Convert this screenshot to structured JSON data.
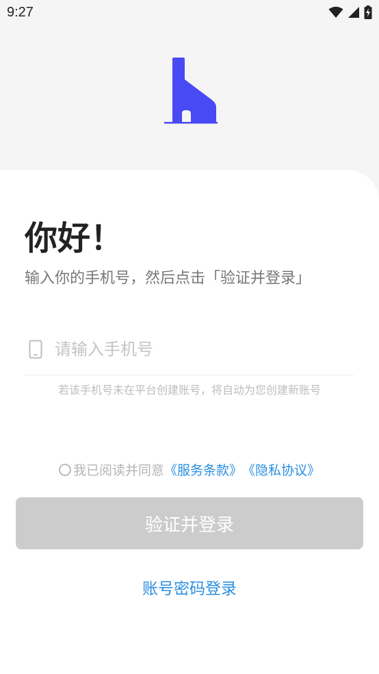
{
  "status_bar": {
    "time": "9:27",
    "icons": [
      "wifi-icon",
      "signal-icon",
      "battery-charging-icon"
    ]
  },
  "colors": {
    "brand": "#4a4af4",
    "link": "#2b8fe0",
    "button_disabled": "#cccccc",
    "background": "#f5f5f5"
  },
  "login": {
    "greeting": "你好！",
    "subtitle": "输入你的手机号，然后点击「验证并登录」",
    "phone_placeholder": "请输入手机号",
    "phone_value": "",
    "hint": "若该手机号未在平台创建账号，将自动为您创建新账号",
    "agreement": {
      "prefix": "我已阅读并同意",
      "terms_link": "《服务条款》",
      "privacy_link": "《隐私协议》"
    },
    "submit_label": "验证并登录",
    "password_login_label": "账号密码登录"
  }
}
